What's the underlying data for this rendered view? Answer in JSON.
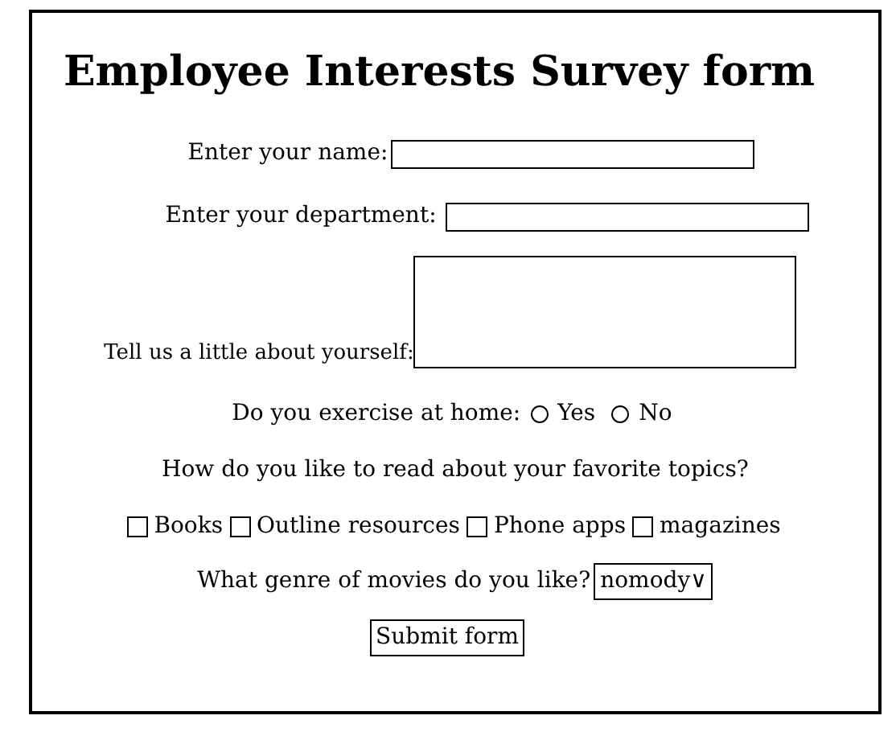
{
  "title": "Employee Interests Survey form",
  "name_field": {
    "label": "Enter your name:"
  },
  "department_field": {
    "label": "Enter your department:"
  },
  "about_field": {
    "label": "Tell us a little about yourself:"
  },
  "exercise": {
    "question": "Do you exercise at home:",
    "options": [
      {
        "label": "Yes",
        "selected": false
      },
      {
        "label": "No",
        "selected": false
      }
    ]
  },
  "reading_question": "How do you like to read about your favorite topics?",
  "reading_options": [
    {
      "label": "Books",
      "checked": false
    },
    {
      "label": "Outline resources",
      "checked": false
    },
    {
      "label": "Phone apps",
      "checked": false
    },
    {
      "label": "magazines",
      "checked": false
    }
  ],
  "genre": {
    "question": "What genre of movies do you like?",
    "value": "nomody",
    "arrow": "∨"
  },
  "submit": "Submit form"
}
